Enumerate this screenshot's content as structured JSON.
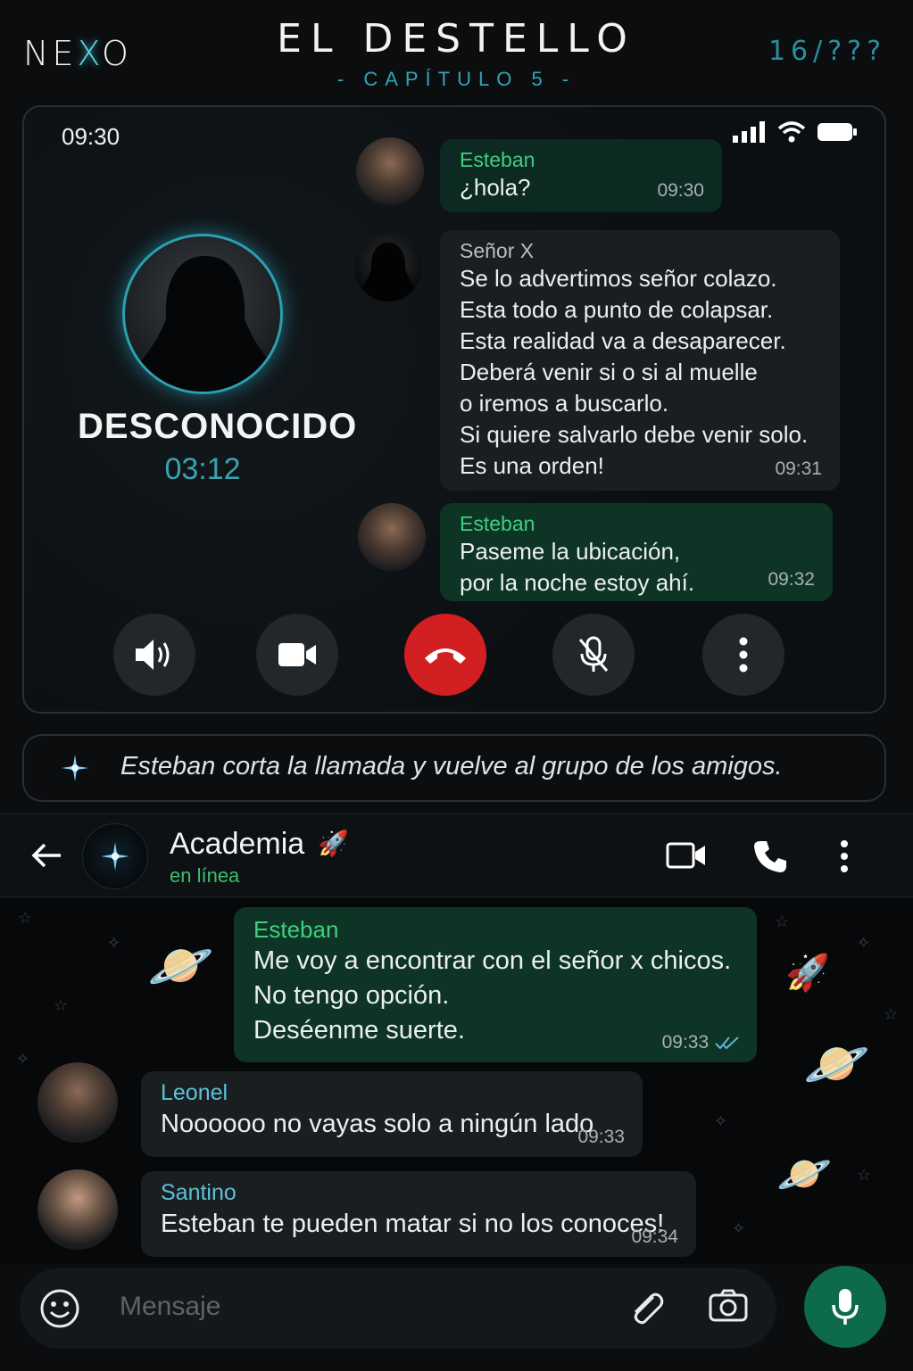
{
  "header": {
    "logo": "NEXO",
    "title": "EL DESTELLO",
    "chapter": "- CAPÍTULO 5 -",
    "page_count": "16/???"
  },
  "call": {
    "status_time": "09:30",
    "caller_name": "DESCONOCIDO",
    "duration": "03:12",
    "messages": [
      {
        "sender": "Esteban",
        "lines": [
          "¿hola?"
        ],
        "time": "09:30"
      },
      {
        "sender": "Señor X",
        "lines": [
          "Se lo advertimos señor colazo.",
          "Esta todo a punto de colapsar.",
          "Esta realidad va a desaparecer.",
          "Deberá venir si o si al muelle",
          "o iremos a buscarlo.",
          "Si quiere salvarlo debe venir solo.",
          "Es una orden!"
        ],
        "time": "09:31"
      },
      {
        "sender": "Esteban",
        "lines": [
          "Paseme la ubicación,",
          "por la noche estoy ahí."
        ],
        "time": "09:32"
      }
    ],
    "buttons": [
      "speaker-icon",
      "video-icon",
      "end-call-icon",
      "mic-off-icon",
      "more-icon"
    ]
  },
  "narration": "Esteban corta la llamada y vuelve al grupo de los amigos.",
  "chat": {
    "group_name": "Academia",
    "group_emoji": "🚀",
    "status": "en línea",
    "messages": [
      {
        "sender": "Esteban",
        "lines": [
          "Me voy a encontrar con el señor x chicos.",
          "No tengo opción.",
          "Deséenme suerte."
        ],
        "time": "09:33"
      },
      {
        "sender": "Leonel",
        "lines": [
          "Noooooo no vayas solo a ningún lado"
        ],
        "time": "09:33"
      },
      {
        "sender": "Santino",
        "lines": [
          "Esteban te pueden matar si no los conoces!"
        ],
        "time": "09:34"
      }
    ],
    "input_placeholder": "Mensaje"
  },
  "colors": {
    "accent_teal": "#2fa6b6",
    "green_bubble": "#0e3426",
    "end_call_red": "#d21f21",
    "mic_green": "#0d6a4a"
  }
}
